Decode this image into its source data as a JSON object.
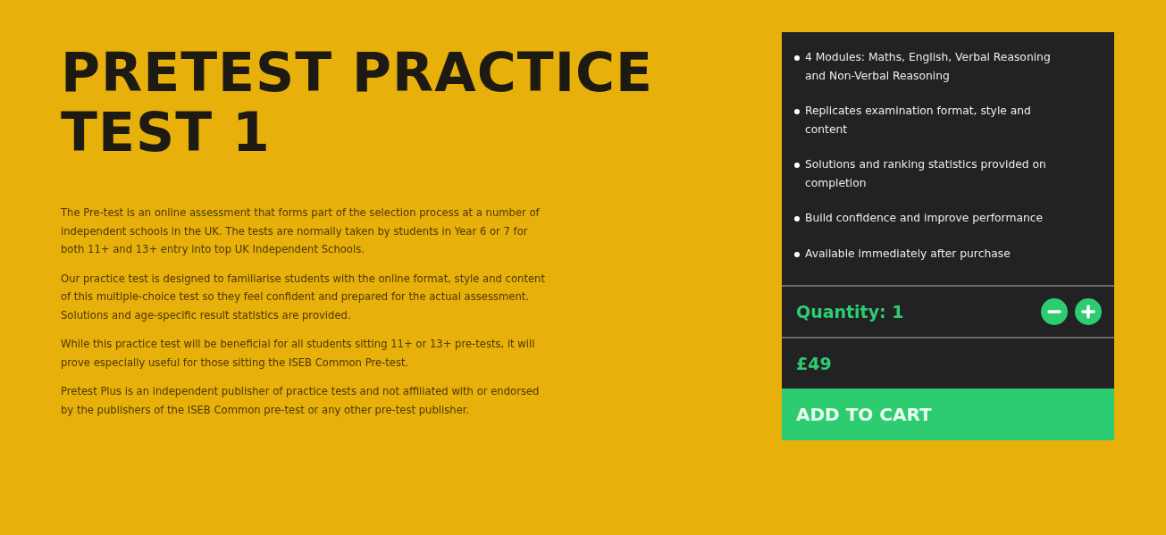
{
  "title": "PRETEST PRACTICE TEST 1",
  "paragraphs": [
    "The Pre-test is an online assessment that forms part of the selection process at a number of independent schools in the UK. The tests are normally taken by students in Year 6 or 7 for both 11+ and 13+ entry into top UK Independent Schools.",
    "Our practice test is designed to familiarise students with the online format, style and content of this multiple-choice test so they feel confident and prepared for the actual assessment. Solutions and age-specific result statistics are provided.",
    "While this practice test will be beneficial for all students sitting 11+ or 13+ pre-tests, it will prove especially useful for those sitting the ISEB Common Pre-test.",
    "Pretest Plus is an independent publisher of practice tests and not affiliated with or endorsed by the publishers of the ISEB Common pre-test or any other pre-test publisher."
  ],
  "features": [
    "4 Modules: Maths, English, Verbal Reasoning and Non-Verbal Reasoning",
    "Replicates examination format, style and content",
    "Solutions and ranking statistics provided on completion",
    "Build confidence and improve performance",
    "Available immediately after purchase"
  ],
  "quantity": "Quantity: 1",
  "price": "£49",
  "add_to_cart": "ADD TO CART"
}
